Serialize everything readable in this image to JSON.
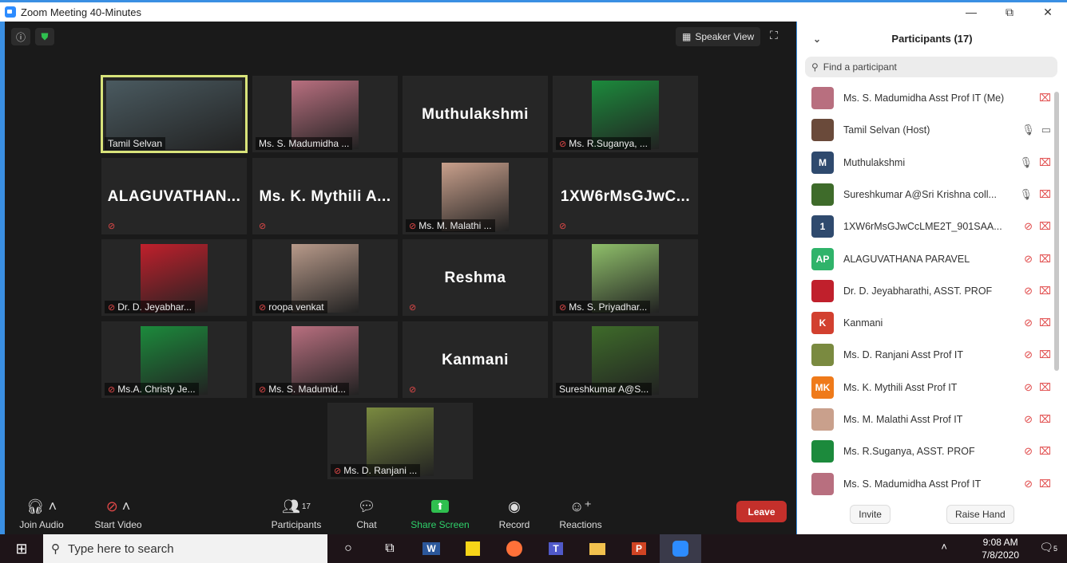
{
  "window": {
    "title": "Zoom Meeting 40-Minutes",
    "minimize": "—",
    "restore": "⧉",
    "close": "✕"
  },
  "meeting": {
    "speaker_view": "Speaker View",
    "tiles": [
      {
        "name": "Tamil Selvan",
        "big": "",
        "muted": false,
        "active": true,
        "photo": "#4a5a60"
      },
      {
        "name": "Ms. S. Madumidha ...",
        "big": "",
        "muted": false,
        "photo": "#b86f7f"
      },
      {
        "name": "",
        "big": "Muthulakshmi",
        "muted": false
      },
      {
        "name": "Ms. R.Suganya, ...",
        "big": "",
        "muted": true,
        "photo": "#1c8a3c"
      },
      {
        "name": "",
        "big": "ALAGUVATHAN...",
        "muted": true
      },
      {
        "name": "",
        "big": "Ms. K. Mythili A...",
        "muted": true
      },
      {
        "name": "Ms. M. Malathi ...",
        "big": "",
        "muted": true,
        "photo": "#c9a08c"
      },
      {
        "name": "",
        "big": "1XW6rMsGJwC...",
        "muted": true
      },
      {
        "name": "Dr. D. Jeyabhar...",
        "big": "",
        "muted": true,
        "photo": "#c0202c"
      },
      {
        "name": "roopa venkat",
        "big": "",
        "muted": true,
        "photo": "#b89a8a"
      },
      {
        "name": "",
        "big": "Reshma",
        "muted": true
      },
      {
        "name": "Ms. S. Priyadhar...",
        "big": "",
        "muted": true,
        "photo": "#8fbf6a"
      },
      {
        "name": "Ms.A. Christy Je...",
        "big": "",
        "muted": true,
        "photo": "#1c8a3c"
      },
      {
        "name": "Ms. S. Madumid...",
        "big": "",
        "muted": true,
        "photo": "#b86f7f"
      },
      {
        "name": "",
        "big": "Kanmani",
        "muted": true
      },
      {
        "name": "Sureshkumar A@S...",
        "big": "",
        "muted": false,
        "photo": "#3e6b2a"
      },
      {
        "name": "Ms. D. Ranjani ...",
        "big": "",
        "muted": true,
        "photo": "#7a8a40"
      }
    ]
  },
  "toolbar": {
    "join_audio": "Join Audio",
    "start_video": "Start Video",
    "participants": "Participants",
    "participants_count": "17",
    "chat": "Chat",
    "share_screen": "Share Screen",
    "record": "Record",
    "reactions": "Reactions",
    "leave": "Leave"
  },
  "panel": {
    "title": "Participants (17)",
    "search_placeholder": "Find a participant",
    "invite": "Invite",
    "raise_hand": "Raise Hand",
    "participants": [
      {
        "name": "Ms. S. Madumidha Asst Prof IT (Me)",
        "initials": "",
        "color": "#b86f7f",
        "mic": "none",
        "cam": "off"
      },
      {
        "name": "Tamil Selvan (Host)",
        "initials": "",
        "color": "#6a4a3a",
        "mic": "on",
        "cam": "on"
      },
      {
        "name": "Muthulakshmi",
        "initials": "M",
        "color": "#2f4a6e",
        "mic": "on",
        "cam": "off"
      },
      {
        "name": "Sureshkumar A@Sri Krishna coll...",
        "initials": "",
        "color": "#3e6b2a",
        "mic": "on",
        "cam": "off"
      },
      {
        "name": "1XW6rMsGJwCcLME2T_901SAA...",
        "initials": "1",
        "color": "#2f4a6e",
        "mic": "off",
        "cam": "off"
      },
      {
        "name": "ALAGUVATHANA PARAVEL",
        "initials": "AP",
        "color": "#2fb36a",
        "mic": "off",
        "cam": "off"
      },
      {
        "name": "Dr. D. Jeyabharathi, ASST. PROF",
        "initials": "",
        "color": "#c0202c",
        "mic": "off",
        "cam": "off"
      },
      {
        "name": "Kanmani",
        "initials": "K",
        "color": "#d2402f",
        "mic": "off",
        "cam": "off"
      },
      {
        "name": "Ms. D. Ranjani Asst Prof IT",
        "initials": "",
        "color": "#7a8a40",
        "mic": "off",
        "cam": "off"
      },
      {
        "name": "Ms. K. Mythili Asst Prof IT",
        "initials": "MK",
        "color": "#ef7a1a",
        "mic": "off",
        "cam": "off"
      },
      {
        "name": "Ms. M. Malathi Asst Prof IT",
        "initials": "",
        "color": "#c9a08c",
        "mic": "off",
        "cam": "off"
      },
      {
        "name": "Ms. R.Suganya, ASST. PROF",
        "initials": "",
        "color": "#1c8a3c",
        "mic": "off",
        "cam": "off"
      },
      {
        "name": "Ms. S. Madumidha Asst Prof IT",
        "initials": "",
        "color": "#b86f7f",
        "mic": "off",
        "cam": "off"
      }
    ]
  },
  "taskbar": {
    "search_placeholder": "Type here to search",
    "time": "9:08 AM",
    "date": "7/8/2020",
    "notifications": "5"
  }
}
